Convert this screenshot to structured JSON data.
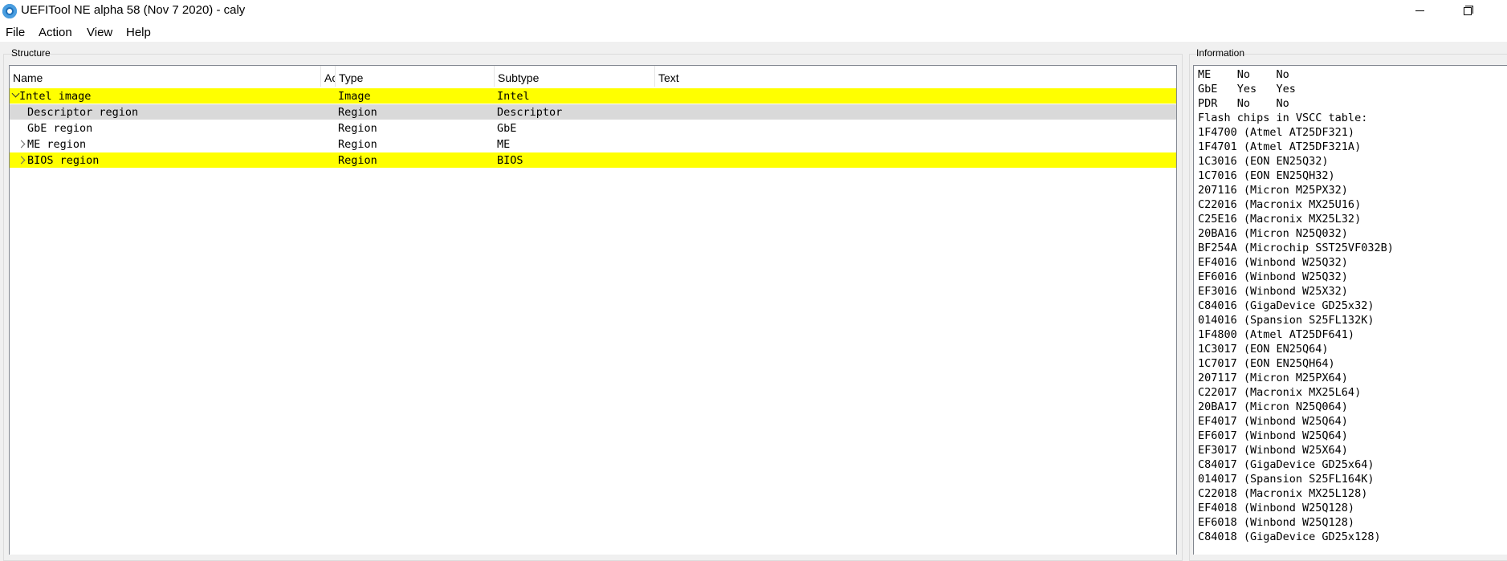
{
  "window": {
    "title": "UEFITool NE alpha 58 (Nov  7 2020) - caly",
    "app_icon": "gear-icon"
  },
  "menu": [
    "File",
    "Action",
    "View",
    "Help"
  ],
  "structure": {
    "label": "Structure",
    "columns": [
      "Name",
      "Ac",
      "Type",
      "Subtype",
      "Text"
    ],
    "rows": [
      {
        "name": "Intel image",
        "type": "Image",
        "subtype": "Intel",
        "text": "",
        "expander": "expanded",
        "highlight": "#ffff00"
      },
      {
        "name": "Descriptor region",
        "type": "Region",
        "subtype": "Descriptor",
        "text": "",
        "expander": "none",
        "highlight": "#d9d9d9"
      },
      {
        "name": "GbE region",
        "type": "Region",
        "subtype": "GbE",
        "text": "",
        "expander": "none",
        "highlight": ""
      },
      {
        "name": "ME region",
        "type": "Region",
        "subtype": "ME",
        "text": "",
        "expander": "collapsed",
        "highlight": ""
      },
      {
        "name": "BIOS region",
        "type": "Region",
        "subtype": "BIOS",
        "text": "",
        "expander": "collapsed",
        "highlight": "#ffff00"
      }
    ]
  },
  "information": {
    "label": "Information",
    "lines": [
      "ME    No    No",
      "GbE   Yes   Yes",
      "PDR   No    No",
      "Flash chips in VSCC table:",
      "1F4700 (Atmel AT25DF321)",
      "1F4701 (Atmel AT25DF321A)",
      "1C3016 (EON EN25Q32)",
      "1C7016 (EON EN25QH32)",
      "207116 (Micron M25PX32)",
      "C22016 (Macronix MX25U16)",
      "C25E16 (Macronix MX25L32)",
      "20BA16 (Micron N25Q032)",
      "BF254A (Microchip SST25VF032B)",
      "EF4016 (Winbond W25Q32)",
      "EF6016 (Winbond W25Q32)",
      "EF3016 (Winbond W25X32)",
      "C84016 (GigaDevice GD25x32)",
      "014016 (Spansion S25FL132K)",
      "1F4800 (Atmel AT25DF641)",
      "1C3017 (EON EN25Q64)",
      "1C7017 (EON EN25QH64)",
      "207117 (Micron M25PX64)",
      "C22017 (Macronix MX25L64)",
      "20BA17 (Micron N25Q064)",
      "EF4017 (Winbond W25Q64)",
      "EF6017 (Winbond W25Q64)",
      "EF3017 (Winbond W25X64)",
      "C84017 (GigaDevice GD25x64)",
      "014017 (Spansion S25FL164K)",
      "C22018 (Macronix MX25L128)",
      "EF4018 (Winbond W25Q128)",
      "EF6018 (Winbond W25Q128)",
      "C84018 (GigaDevice GD25x128)"
    ]
  }
}
